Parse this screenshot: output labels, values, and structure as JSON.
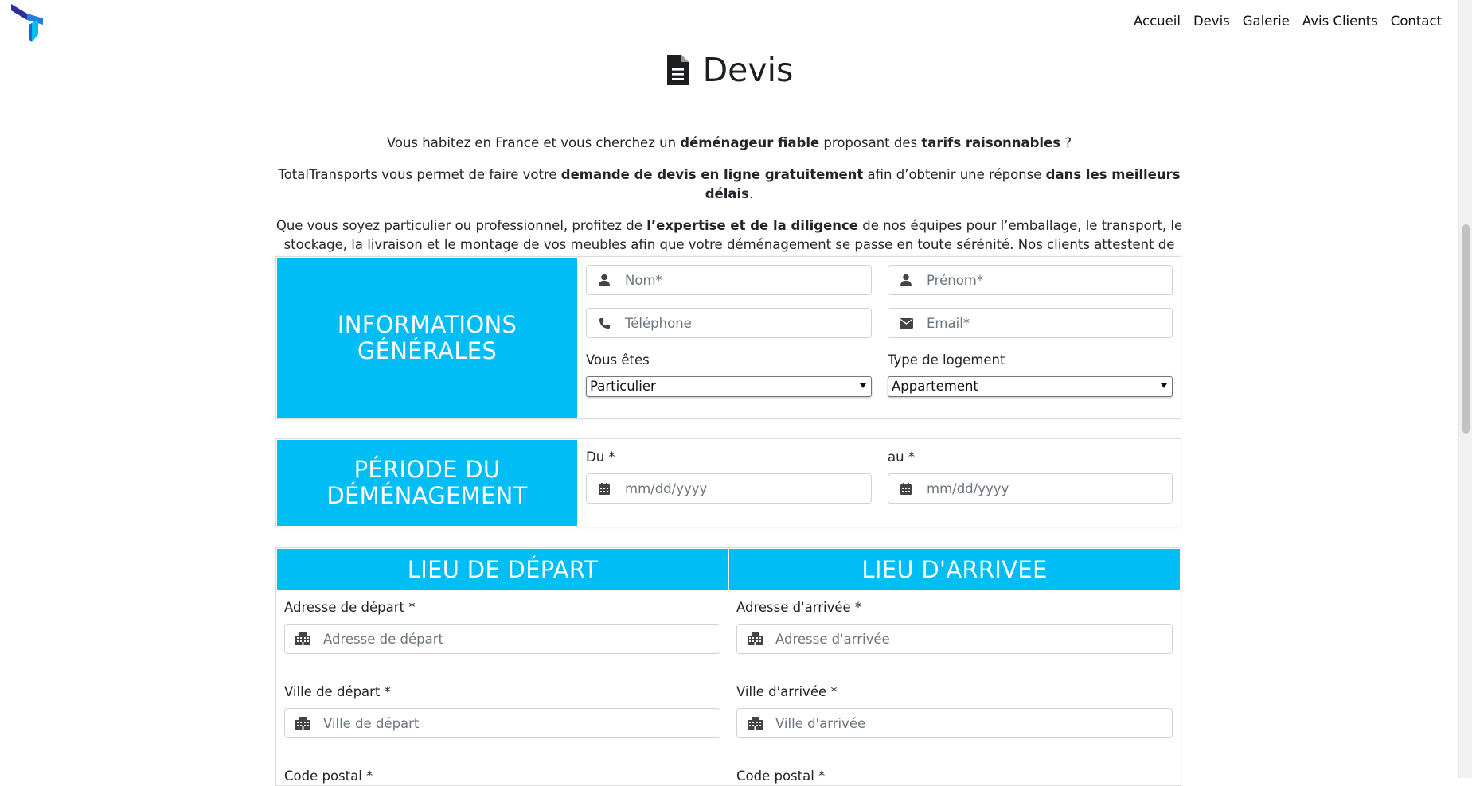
{
  "brand": {
    "accent": "#00bdf5",
    "logo_colors": [
      "#2c2ea0",
      "#1e7fe0",
      "#00bdf5"
    ]
  },
  "nav": {
    "items": [
      {
        "label": "Accueil"
      },
      {
        "label": "Devis"
      },
      {
        "label": "Galerie"
      },
      {
        "label": "Avis Clients"
      },
      {
        "label": "Contact"
      }
    ]
  },
  "page": {
    "icon": "file-text-icon",
    "title": "Devis"
  },
  "intro": {
    "p1": [
      {
        "t": "Vous habitez en France et vous cherchez un ",
        "b": false
      },
      {
        "t": "déménageur fiable",
        "b": true
      },
      {
        "t": " proposant des ",
        "b": false
      },
      {
        "t": "tarifs raisonnables",
        "b": true
      },
      {
        "t": " ?",
        "b": false
      }
    ],
    "p2": [
      {
        "t": "TotalTransports vous permet de faire votre ",
        "b": false
      },
      {
        "t": "demande de devis en ligne gratuitement",
        "b": true
      },
      {
        "t": " afin d’obtenir une réponse ",
        "b": false
      },
      {
        "t": "dans les meilleurs délais",
        "b": true
      },
      {
        "t": ".",
        "b": false
      }
    ],
    "p3": [
      {
        "t": "Que vous soyez particulier ou professionnel, profitez de ",
        "b": false
      },
      {
        "t": "l’expertise et de la diligence",
        "b": true
      },
      {
        "t": " de nos équipes pour l’emballage, le transport, le stockage, la livraison et le montage de vos meubles afin que votre déménagement se passe en toute sérénité. Nos clients attestent de notre efficacité !",
        "b": false
      }
    ]
  },
  "general": {
    "heading_line1": "Informations",
    "heading_line2": "générales",
    "nom": {
      "placeholder": "Nom*",
      "value": "",
      "icon": "user-icon"
    },
    "prenom": {
      "placeholder": "Prénom*",
      "value": "",
      "icon": "user-icon"
    },
    "telephone": {
      "placeholder": "Téléphone",
      "value": "",
      "icon": "phone-icon"
    },
    "email": {
      "placeholder": "Email*",
      "value": "",
      "icon": "envelope-icon"
    },
    "vous_etes": {
      "label": "Vous êtes",
      "selected": "Particulier"
    },
    "logement": {
      "label": "Type de logement",
      "selected": "Appartement"
    }
  },
  "period": {
    "heading_line1": "Période du",
    "heading_line2": "déménagement",
    "du": {
      "label": "Du *",
      "placeholder": "mm/dd/yyyy",
      "icon": "calendar-icon"
    },
    "au": {
      "label": "au *",
      "placeholder": "mm/dd/yyyy",
      "icon": "calendar-icon"
    }
  },
  "locations": {
    "depart": {
      "heading": "Lieu de départ",
      "address": {
        "label": "Adresse de départ *",
        "placeholder": "Adresse de départ",
        "icon": "building-icon"
      },
      "city": {
        "label": "Ville de départ *",
        "placeholder": "Ville de départ",
        "icon": "building-icon"
      },
      "postal": {
        "label": "Code postal *"
      }
    },
    "arrivee": {
      "heading": "Lieu d'arrivee",
      "address": {
        "label": "Adresse d'arrivée *",
        "placeholder": "Adresse d'arrivée",
        "icon": "building-icon"
      },
      "city": {
        "label": "Ville d'arrivée *",
        "placeholder": "Ville d'arrivée",
        "icon": "building-icon"
      },
      "postal": {
        "label": "Code postal *"
      }
    }
  }
}
